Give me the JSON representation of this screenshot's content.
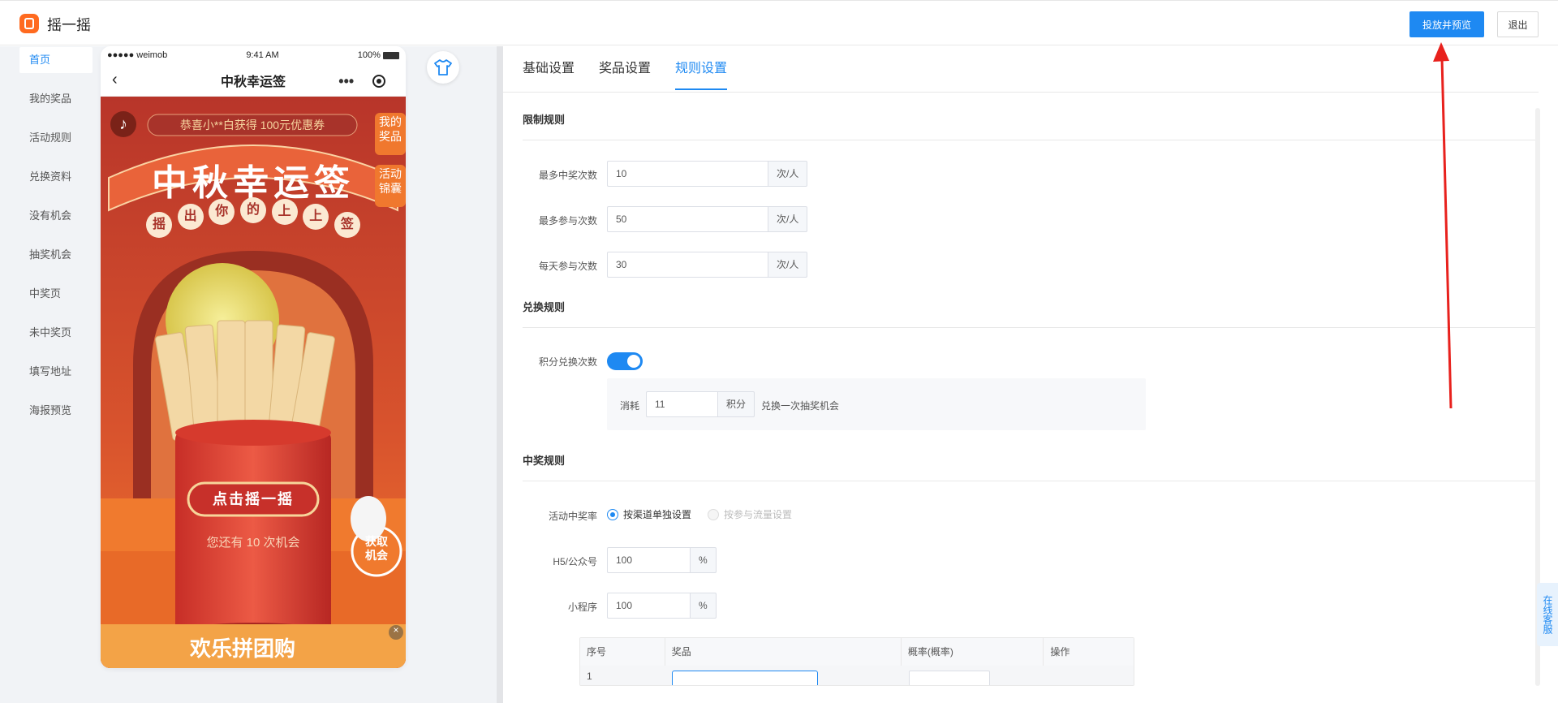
{
  "app": {
    "title": "摇一摇"
  },
  "header": {
    "publish_label": "投放并预览",
    "exit_label": "退出"
  },
  "sidebar": {
    "items": [
      {
        "label": "首页",
        "active": true
      },
      {
        "label": "我的奖品"
      },
      {
        "label": "活动规则"
      },
      {
        "label": "兑换资料"
      },
      {
        "label": "没有机会"
      },
      {
        "label": "抽奖机会"
      },
      {
        "label": "中奖页"
      },
      {
        "label": "未中奖页"
      },
      {
        "label": "填写地址"
      },
      {
        "label": "海报预览"
      }
    ]
  },
  "phone": {
    "carrier": "●●●●● weimob",
    "time": "9:41 AM",
    "battery": "100%",
    "nav_title": "中秋幸运签",
    "marquee": "恭喜小**白获得 100元优惠券",
    "side_btn_1": "我的奖品",
    "side_btn_2": "活动锦囊",
    "banner_title": "中秋幸运签",
    "banner_sub": [
      "摇",
      "出",
      "你",
      "的",
      "上",
      "上",
      "签"
    ],
    "shake_btn": "点击摇一摇",
    "chance_text": "您还有 10 次机会",
    "get_chance": "获取机会",
    "bottom_banner": "欢乐拼团购",
    "close_mark": "×"
  },
  "tabs": [
    {
      "label": "基础设置"
    },
    {
      "label": "奖品设置"
    },
    {
      "label": "规则设置",
      "active": true
    }
  ],
  "sections": {
    "limit": "限制规则",
    "exchange": "兑换规则",
    "win": "中奖规则"
  },
  "limit_rules": [
    {
      "label": "最多中奖次数",
      "value": "10",
      "suffix": "次/人"
    },
    {
      "label": "最多参与次数",
      "value": "50",
      "suffix": "次/人"
    },
    {
      "label": "每天参与次数",
      "value": "30",
      "suffix": "次/人"
    }
  ],
  "exchange": {
    "label": "积分兑换次数",
    "enabled": true,
    "consume_label": "消耗",
    "value": "11",
    "suffix": "积分",
    "desc": "兑换一次抽奖机会"
  },
  "win_rules": {
    "rate_label": "活动中奖率",
    "option_1": "按渠道单独设置",
    "option_2": "按参与流量设置",
    "h5_label": "H5/公众号",
    "h5_value": "100",
    "pct": "%",
    "mini_label": "小程序",
    "mini_value": "100"
  },
  "table": {
    "headers": [
      "序号",
      "奖品",
      "概率(概率)",
      "操作"
    ],
    "first_index": "1"
  },
  "customer_service": "在线客服",
  "colors": {
    "accent": "#1e89f2",
    "brand": "#ff6a1f",
    "annotation": "#e8211d"
  }
}
